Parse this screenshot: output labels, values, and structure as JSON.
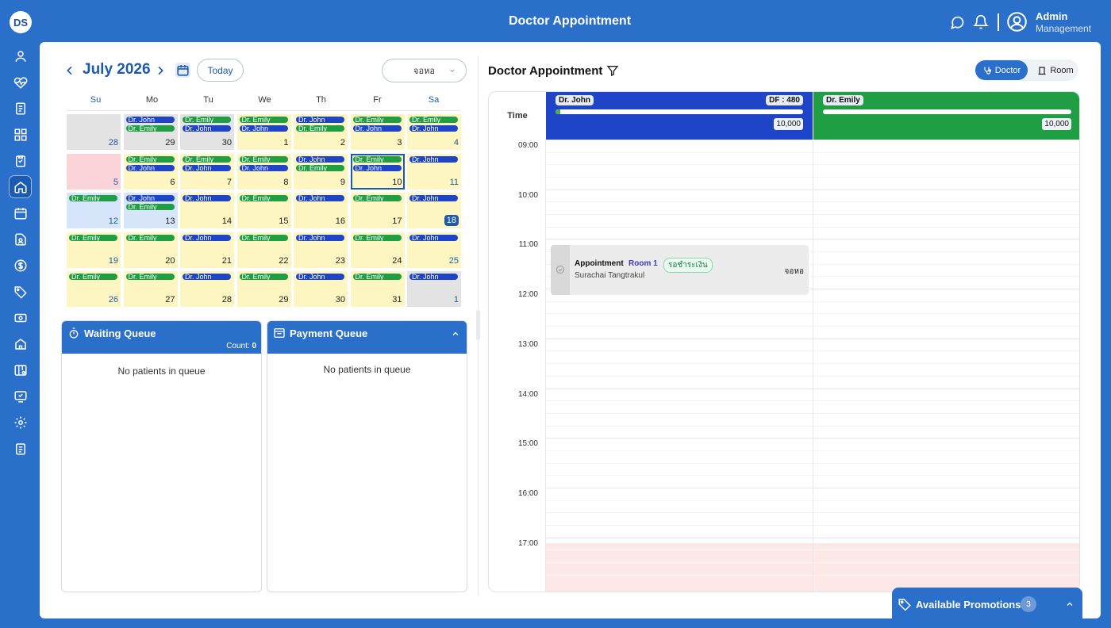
{
  "app": {
    "logo": "DS",
    "title": "Doctor Appointment"
  },
  "user": {
    "name": "Admin",
    "role": "Management"
  },
  "header_icons": [
    "chat-icon",
    "bell-icon",
    "user-circle-icon"
  ],
  "sidebar": {
    "items": [
      {
        "icon": "user-icon"
      },
      {
        "icon": "heart-pulse-icon"
      },
      {
        "icon": "document-icon"
      },
      {
        "icon": "dashboard-icon"
      },
      {
        "icon": "clipboard-icon"
      },
      {
        "icon": "home-icon",
        "active": true
      },
      {
        "icon": "calendar-icon"
      },
      {
        "icon": "file-user-icon"
      },
      {
        "icon": "dollar-icon"
      },
      {
        "icon": "tag-icon"
      },
      {
        "icon": "cash-icon"
      },
      {
        "icon": "house-icon"
      },
      {
        "icon": "layout-settings-icon"
      },
      {
        "icon": "monitor-check-icon"
      },
      {
        "icon": "gear-icon"
      },
      {
        "icon": "list-icon"
      }
    ]
  },
  "calendar": {
    "month_label": "July 2026",
    "today_label": "Today",
    "room_select_value": "จอหอ",
    "weekdays": [
      "Su",
      "Mo",
      "Tu",
      "We",
      "Th",
      "Fr",
      "Sa"
    ],
    "weeks": [
      [
        {
          "num": "28",
          "state": "past",
          "events": []
        },
        {
          "num": "29",
          "state": "past",
          "events": [
            "Dr. John",
            "Dr. Emily"
          ]
        },
        {
          "num": "30",
          "state": "past",
          "events": [
            "Dr. Emily",
            "Dr. John"
          ]
        },
        {
          "num": "1",
          "state": "open",
          "events": [
            "Dr. Emily",
            "Dr. John"
          ]
        },
        {
          "num": "2",
          "state": "open",
          "events": [
            "Dr. John",
            "Dr. Emily"
          ]
        },
        {
          "num": "3",
          "state": "open",
          "events": [
            "Dr. Emily",
            "Dr. John"
          ]
        },
        {
          "num": "4",
          "state": "open",
          "events": [
            "Dr. Emily",
            "Dr. John"
          ]
        }
      ],
      [
        {
          "num": "5",
          "state": "holiday",
          "events": []
        },
        {
          "num": "6",
          "state": "open",
          "events": [
            "Dr. Emily",
            "Dr. John"
          ]
        },
        {
          "num": "7",
          "state": "open",
          "events": [
            "Dr. Emily",
            "Dr. John"
          ]
        },
        {
          "num": "8",
          "state": "open",
          "events": [
            "Dr. Emily",
            "Dr. John"
          ]
        },
        {
          "num": "9",
          "state": "open",
          "events": [
            "Dr. John",
            "Dr. Emily"
          ]
        },
        {
          "num": "10",
          "state": "selected",
          "events": [
            "Dr. Emily",
            "Dr. John"
          ]
        },
        {
          "num": "11",
          "state": "open",
          "events": [
            "Dr. John"
          ]
        }
      ],
      [
        {
          "num": "12",
          "state": "blue",
          "events": [
            "Dr. Emily"
          ]
        },
        {
          "num": "13",
          "state": "blue",
          "events": [
            "Dr. John",
            "Dr. Emily"
          ]
        },
        {
          "num": "14",
          "state": "open",
          "events": [
            "Dr. John"
          ]
        },
        {
          "num": "15",
          "state": "open",
          "events": [
            "Dr. Emily"
          ]
        },
        {
          "num": "16",
          "state": "open",
          "events": [
            "Dr. John"
          ]
        },
        {
          "num": "17",
          "state": "open",
          "events": [
            "Dr. Emily"
          ]
        },
        {
          "num": "18",
          "state": "today",
          "events": [
            "Dr. John"
          ]
        }
      ],
      [
        {
          "num": "19",
          "state": "open",
          "events": [
            "Dr. Emily"
          ]
        },
        {
          "num": "20",
          "state": "open",
          "events": [
            "Dr. Emily"
          ]
        },
        {
          "num": "21",
          "state": "open",
          "events": [
            "Dr. John"
          ]
        },
        {
          "num": "22",
          "state": "open",
          "events": [
            "Dr. Emily"
          ]
        },
        {
          "num": "23",
          "state": "open",
          "events": [
            "Dr. John"
          ]
        },
        {
          "num": "24",
          "state": "open",
          "events": [
            "Dr. Emily"
          ]
        },
        {
          "num": "25",
          "state": "open",
          "events": [
            "Dr. John"
          ]
        }
      ],
      [
        {
          "num": "26",
          "state": "open",
          "events": [
            "Dr. Emily"
          ]
        },
        {
          "num": "27",
          "state": "open",
          "events": [
            "Dr. Emily"
          ]
        },
        {
          "num": "28",
          "state": "open",
          "events": [
            "Dr. John"
          ]
        },
        {
          "num": "29",
          "state": "open",
          "events": [
            "Dr. Emily"
          ]
        },
        {
          "num": "30",
          "state": "open",
          "events": [
            "Dr. John"
          ]
        },
        {
          "num": "31",
          "state": "open",
          "events": [
            "Dr. Emily"
          ]
        },
        {
          "num": "1",
          "state": "past",
          "events": [
            "Dr. John"
          ]
        }
      ]
    ]
  },
  "waiting_queue": {
    "title": "Waiting Queue",
    "count_label": "Count:",
    "count": "0",
    "empty": "No patients in queue"
  },
  "payment_queue": {
    "title": "Payment Queue",
    "empty": "No patients in queue"
  },
  "schedule": {
    "title": "Doctor Appointment",
    "view_toggle": {
      "doctor": "Doctor",
      "room": "Room",
      "selected": "doctor"
    },
    "time_header": "Time",
    "doctors": [
      {
        "name": "Dr. John",
        "df": "DF : 480",
        "progress": 0.02,
        "target": "10,000",
        "color": "#1e45c7"
      },
      {
        "name": "Dr. Emily",
        "df": "",
        "progress": 0,
        "target": "10,000",
        "color": "#1f9e44"
      }
    ],
    "hours": [
      "09:00",
      "10:00",
      "11:00",
      "12:00",
      "13:00",
      "14:00",
      "15:00",
      "16:00",
      "17:00"
    ],
    "appointment": {
      "type": "Appointment",
      "room": "Room 1",
      "status": "รอชำระเงิน",
      "patient": "Surachai Tangtrakul",
      "location": "จอหอ"
    }
  },
  "promotions": {
    "label": "Available Promotions",
    "count": "3"
  }
}
